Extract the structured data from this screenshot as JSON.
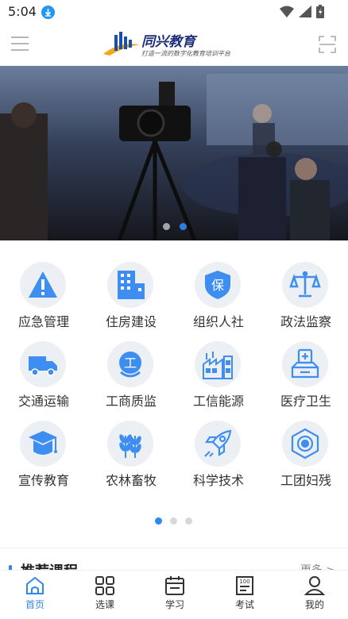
{
  "status_bar": {
    "time": "5:04"
  },
  "header": {
    "logo_name": "同兴教育",
    "logo_slogan": "打造一流的数字化教育培训平台"
  },
  "banner": {
    "page_count": 2,
    "active_index": 1
  },
  "categories": [
    {
      "label": "应急管理",
      "icon": "warning-icon"
    },
    {
      "label": "住房建设",
      "icon": "building-icon"
    },
    {
      "label": "组织人社",
      "icon": "shield-bao-icon"
    },
    {
      "label": "政法监察",
      "icon": "scales-icon"
    },
    {
      "label": "交通运输",
      "icon": "truck-icon"
    },
    {
      "label": "工商质监",
      "icon": "badge-gong-icon"
    },
    {
      "label": "工信能源",
      "icon": "factory-icon"
    },
    {
      "label": "医疗卫生",
      "icon": "medical-icon"
    },
    {
      "label": "宣传教育",
      "icon": "graduation-cap-icon"
    },
    {
      "label": "农林畜牧",
      "icon": "wheat-icon"
    },
    {
      "label": "科学技术",
      "icon": "rocket-icon"
    },
    {
      "label": "工团妇残",
      "icon": "union-badge-icon"
    }
  ],
  "grid_pager": {
    "page_count": 3,
    "active_index": 0
  },
  "recommended": {
    "title": "推荐课程",
    "more": "更多 >"
  },
  "tabbar": [
    {
      "label": "首页",
      "icon": "home-icon",
      "active": true
    },
    {
      "label": "选课",
      "icon": "grid-icon",
      "active": false
    },
    {
      "label": "学习",
      "icon": "calendar-icon",
      "active": false
    },
    {
      "label": "考试",
      "icon": "exam-100-icon",
      "active": false
    },
    {
      "label": "我的",
      "icon": "user-icon",
      "active": false
    }
  ],
  "colors": {
    "accent": "#2f88ef",
    "icon_blue": "#3d8ef0",
    "icon_bg": "#eceff3"
  }
}
